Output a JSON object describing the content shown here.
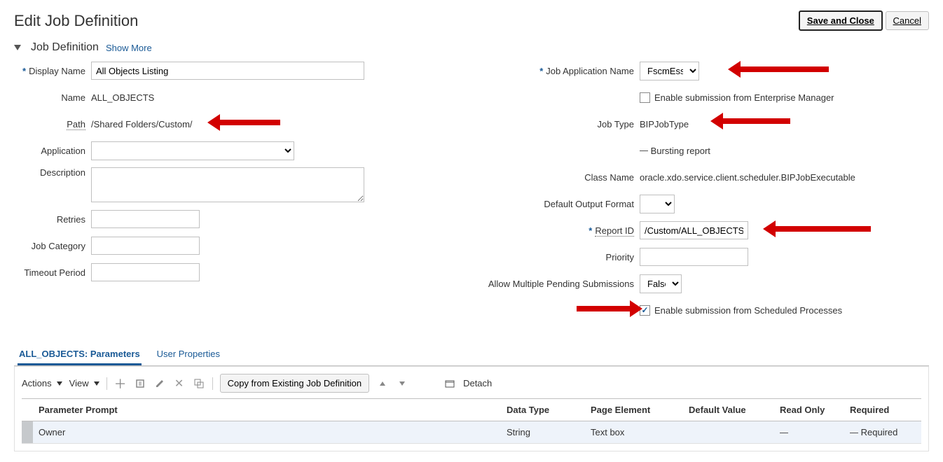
{
  "header": {
    "title": "Edit Job Definition",
    "save_close": "Save and Close",
    "cancel": "Cancel"
  },
  "section": {
    "title": "Job Definition",
    "show_more": "Show More"
  },
  "left": {
    "display_name_label": "Display Name",
    "display_name_value": "All Objects Listing",
    "name_label": "Name",
    "name_value": "ALL_OBJECTS",
    "path_label": "Path",
    "path_value": "/Shared Folders/Custom/",
    "application_label": "Application",
    "application_value": "",
    "description_label": "Description",
    "description_value": "",
    "retries_label": "Retries",
    "retries_value": "",
    "job_category_label": "Job Category",
    "job_category_value": "",
    "timeout_label": "Timeout Period",
    "timeout_value": ""
  },
  "right": {
    "job_app_name_label": "Job Application Name",
    "job_app_name_value": "FscmEss",
    "enable_em_label": "Enable submission from Enterprise Manager",
    "job_type_label": "Job Type",
    "job_type_value": "BIPJobType",
    "bursting_label": "Bursting report",
    "class_name_label": "Class Name",
    "class_name_value": "oracle.xdo.service.client.scheduler.BIPJobExecutable",
    "default_output_label": "Default Output Format",
    "report_id_label": "Report ID",
    "report_id_value": "/Custom/ALL_OBJECTS_R",
    "priority_label": "Priority",
    "priority_value": "",
    "allow_multi_label": "Allow Multiple Pending Submissions",
    "allow_multi_value": "False",
    "enable_sp_label": "Enable submission from Scheduled Processes"
  },
  "tabs": {
    "parameters": "ALL_OBJECTS: Parameters",
    "user_props": "User Properties"
  },
  "toolbar": {
    "actions": "Actions",
    "view": "View",
    "copy": "Copy from Existing Job Definition",
    "detach": "Detach"
  },
  "table": {
    "cols": {
      "prompt": "Parameter Prompt",
      "data_type": "Data Type",
      "page_element": "Page Element",
      "default_value": "Default Value",
      "read_only": "Read Only",
      "required": "Required"
    },
    "rows": [
      {
        "prompt": "Owner",
        "data_type": "String",
        "page_element": "Text box",
        "default_value": "",
        "read_only": "",
        "required": "Required"
      }
    ]
  }
}
